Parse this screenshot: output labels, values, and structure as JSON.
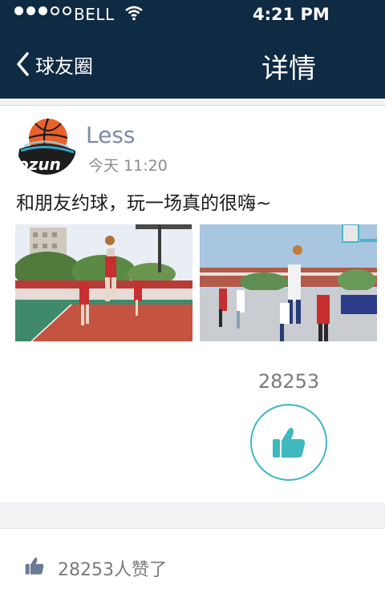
{
  "status_bar": {
    "carrier": "BELL",
    "time": "4:21 PM",
    "signal_bars_filled": 3,
    "signal_bars_total": 5
  },
  "nav": {
    "back_label": "球友圈",
    "title": "详情"
  },
  "post": {
    "username": "Less",
    "time": "今天 11:20",
    "text": "和朋友约球，玩一场真的很嗨~",
    "avatar_text": "ozun",
    "like_count": "28253"
  },
  "likes_summary": {
    "text": "28253人赞了"
  },
  "colors": {
    "header_bg": "#0f2a43",
    "username": "#7b8aa6",
    "accent": "#3fb9bf"
  },
  "icons": {
    "back": "chevron-left-icon",
    "like": "thumbs-up-icon",
    "wifi": "wifi-icon"
  }
}
